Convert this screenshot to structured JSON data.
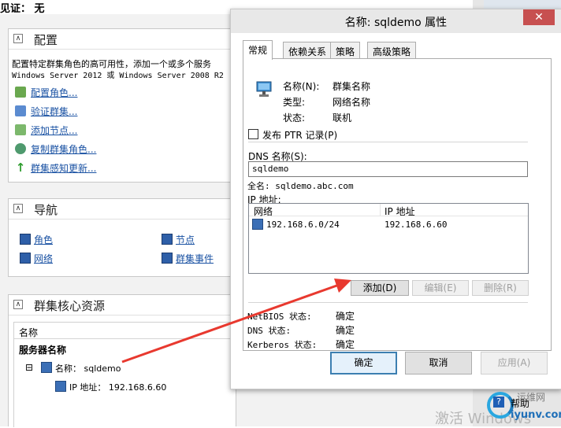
{
  "top_text": "见证： 无",
  "config": {
    "title": "配置",
    "description_line1": "配置特定群集角色的高可用性，添加一个或多个服务",
    "description_line2": "Windows Server 2012 或 Windows Server 2008 R2",
    "links": [
      "配置角色...",
      "验证群集...",
      "添加节点...",
      "复制群集角色...",
      "群集感知更新..."
    ]
  },
  "nav": {
    "title": "导航",
    "links": [
      "角色",
      "节点",
      "网络",
      "群集事件"
    ]
  },
  "core": {
    "title": "群集核心资源",
    "col_header": "名称",
    "group_label": "服务器名称",
    "item_label": "名称： sqldemo",
    "subitem_label": "IP 地址： 192.168.6.60",
    "expand_glyph": "⊟"
  },
  "dialog": {
    "title": "名称: sqldemo 属性",
    "close_glyph": "✕",
    "tabs": [
      "常规",
      "依赖关系",
      "策略",
      "高级策略"
    ],
    "props": [
      {
        "label": "名称(N):",
        "value": "群集名称"
      },
      {
        "label": "类型:",
        "value": "网络名称"
      },
      {
        "label": "状态:",
        "value": "联机"
      }
    ],
    "publish_ptr": "发布 PTR 记录(P)",
    "dns_label": "DNS 名称(S):",
    "dns_value": "sqldemo",
    "fullname": "全名: sqldemo.abc.com",
    "ip_label": "IP 地址:",
    "ip_columns": [
      "网络",
      "IP 地址"
    ],
    "ip_rows": [
      {
        "network": "192.168.6.0/24",
        "ip": "192.168.6.60"
      }
    ],
    "add_btn": "添加(D)",
    "edit_btn": "编辑(E)",
    "remove_btn": "删除(R)",
    "status_rows": [
      {
        "label": "NetBIOS 状态:",
        "value": "确定"
      },
      {
        "label": "DNS 状态:",
        "value": "确定"
      },
      {
        "label": "Kerberos 状态:",
        "value": "确定"
      }
    ],
    "ok_btn": "确定",
    "cancel_btn": "取消",
    "apply_btn": "应用(A)"
  },
  "watermark": {
    "activate": "激活 Windows",
    "site_top": "运维网",
    "site": "iyunv.com",
    "help": "帮助"
  },
  "colors": {
    "link": "#1a52a3",
    "close": "#c75050",
    "arrow": "#e8392f",
    "accent": "#3c7fb1"
  }
}
